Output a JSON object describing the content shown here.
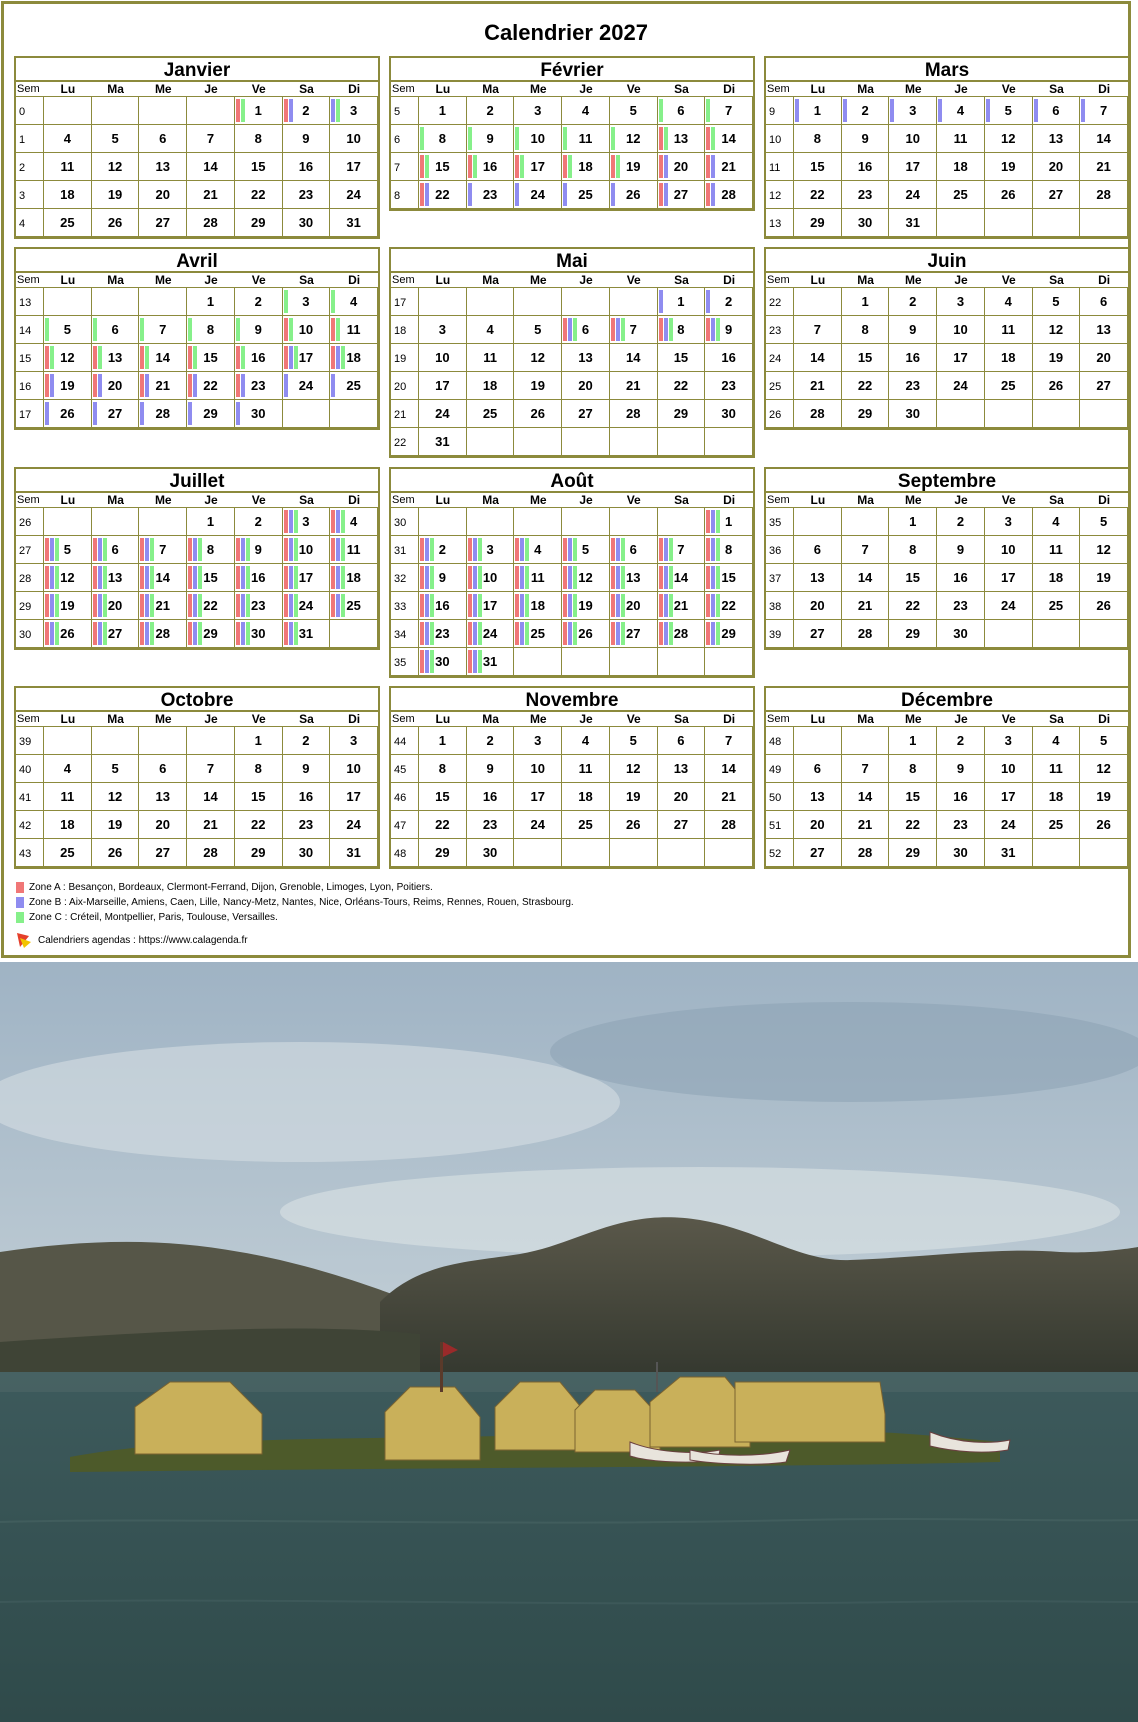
{
  "title": "Calendrier 2027",
  "weekday_header": [
    "Sem",
    "Lu",
    "Ma",
    "Me",
    "Je",
    "Ve",
    "Sa",
    "Di"
  ],
  "months": [
    {
      "name": "Janvier",
      "start": 4,
      "days": 31,
      "weeks": [
        0,
        1,
        2,
        3,
        4
      ],
      "zones": {
        "1": [
          "A",
          "C"
        ],
        "2": [
          "A",
          "B"
        ],
        "3": [
          "B",
          "C"
        ]
      }
    },
    {
      "name": "Février",
      "start": 0,
      "days": 28,
      "weeks": [
        5,
        6,
        7,
        8
      ],
      "zones": {
        "6": [
          "C"
        ],
        "7": [
          "C"
        ],
        "8": [
          "C"
        ],
        "9": [
          "C"
        ],
        "10": [
          "C"
        ],
        "11": [
          "C"
        ],
        "12": [
          "C"
        ],
        "13": [
          "A",
          "C"
        ],
        "14": [
          "A",
          "C"
        ],
        "15": [
          "A",
          "C"
        ],
        "16": [
          "A",
          "C"
        ],
        "17": [
          "A",
          "C"
        ],
        "18": [
          "A",
          "C"
        ],
        "19": [
          "A",
          "C"
        ],
        "20": [
          "A",
          "B"
        ],
        "21": [
          "A",
          "B"
        ],
        "22": [
          "A",
          "B"
        ],
        "23": [
          "B"
        ],
        "24": [
          "B"
        ],
        "25": [
          "B"
        ],
        "26": [
          "B"
        ],
        "27": [
          "A",
          "B"
        ],
        "28": [
          "A",
          "B"
        ]
      }
    },
    {
      "name": "Mars",
      "start": 0,
      "days": 31,
      "weeks": [
        9,
        10,
        11,
        12,
        13
      ],
      "zones": {
        "1": [
          "B"
        ],
        "2": [
          "B"
        ],
        "3": [
          "B"
        ],
        "4": [
          "B"
        ],
        "5": [
          "B"
        ],
        "6": [
          "B"
        ],
        "7": [
          "B"
        ]
      }
    },
    {
      "name": "Avril",
      "start": 3,
      "days": 30,
      "weeks": [
        13,
        14,
        15,
        16,
        17
      ],
      "zones": {
        "3": [
          "C"
        ],
        "4": [
          "C"
        ],
        "5": [
          "C"
        ],
        "6": [
          "C"
        ],
        "7": [
          "C"
        ],
        "8": [
          "C"
        ],
        "9": [
          "C"
        ],
        "10": [
          "A",
          "C"
        ],
        "11": [
          "A",
          "C"
        ],
        "12": [
          "A",
          "C"
        ],
        "13": [
          "A",
          "C"
        ],
        "14": [
          "A",
          "C"
        ],
        "15": [
          "A",
          "C"
        ],
        "16": [
          "A",
          "C"
        ],
        "17": [
          "A",
          "B",
          "C"
        ],
        "18": [
          "A",
          "B",
          "C"
        ],
        "19": [
          "A",
          "B"
        ],
        "20": [
          "A",
          "B"
        ],
        "21": [
          "A",
          "B"
        ],
        "22": [
          "A",
          "B"
        ],
        "23": [
          "A",
          "B"
        ],
        "24": [
          "B"
        ],
        "25": [
          "B"
        ],
        "26": [
          "B"
        ],
        "27": [
          "B"
        ],
        "28": [
          "B"
        ],
        "29": [
          "B"
        ],
        "30": [
          "B"
        ]
      }
    },
    {
      "name": "Mai",
      "start": 5,
      "days": 31,
      "weeks": [
        17,
        18,
        19,
        20,
        21,
        22
      ],
      "zones": {
        "1": [
          "B"
        ],
        "2": [
          "B"
        ],
        "6": [
          "A",
          "B",
          "C"
        ],
        "7": [
          "A",
          "B",
          "C"
        ],
        "8": [
          "A",
          "B",
          "C"
        ],
        "9": [
          "A",
          "B",
          "C"
        ]
      }
    },
    {
      "name": "Juin",
      "start": 1,
      "days": 30,
      "weeks": [
        22,
        23,
        24,
        25,
        26
      ],
      "zones": {}
    },
    {
      "name": "Juillet",
      "start": 3,
      "days": 31,
      "weeks": [
        26,
        27,
        28,
        29,
        30
      ],
      "zones": {
        "3": [
          "A",
          "B",
          "C"
        ],
        "4": [
          "A",
          "B",
          "C"
        ],
        "5": [
          "A",
          "B",
          "C"
        ],
        "6": [
          "A",
          "B",
          "C"
        ],
        "7": [
          "A",
          "B",
          "C"
        ],
        "8": [
          "A",
          "B",
          "C"
        ],
        "9": [
          "A",
          "B",
          "C"
        ],
        "10": [
          "A",
          "B",
          "C"
        ],
        "11": [
          "A",
          "B",
          "C"
        ],
        "12": [
          "A",
          "B",
          "C"
        ],
        "13": [
          "A",
          "B",
          "C"
        ],
        "14": [
          "A",
          "B",
          "C"
        ],
        "15": [
          "A",
          "B",
          "C"
        ],
        "16": [
          "A",
          "B",
          "C"
        ],
        "17": [
          "A",
          "B",
          "C"
        ],
        "18": [
          "A",
          "B",
          "C"
        ],
        "19": [
          "A",
          "B",
          "C"
        ],
        "20": [
          "A",
          "B",
          "C"
        ],
        "21": [
          "A",
          "B",
          "C"
        ],
        "22": [
          "A",
          "B",
          "C"
        ],
        "23": [
          "A",
          "B",
          "C"
        ],
        "24": [
          "A",
          "B",
          "C"
        ],
        "25": [
          "A",
          "B",
          "C"
        ],
        "26": [
          "A",
          "B",
          "C"
        ],
        "27": [
          "A",
          "B",
          "C"
        ],
        "28": [
          "A",
          "B",
          "C"
        ],
        "29": [
          "A",
          "B",
          "C"
        ],
        "30": [
          "A",
          "B",
          "C"
        ],
        "31": [
          "A",
          "B",
          "C"
        ]
      }
    },
    {
      "name": "Août",
      "start": 6,
      "days": 31,
      "weeks": [
        30,
        31,
        32,
        33,
        34,
        35
      ],
      "zones": {
        "1": [
          "A",
          "B",
          "C"
        ],
        "2": [
          "A",
          "B",
          "C"
        ],
        "3": [
          "A",
          "B",
          "C"
        ],
        "4": [
          "A",
          "B",
          "C"
        ],
        "5": [
          "A",
          "B",
          "C"
        ],
        "6": [
          "A",
          "B",
          "C"
        ],
        "7": [
          "A",
          "B",
          "C"
        ],
        "8": [
          "A",
          "B",
          "C"
        ],
        "9": [
          "A",
          "B",
          "C"
        ],
        "10": [
          "A",
          "B",
          "C"
        ],
        "11": [
          "A",
          "B",
          "C"
        ],
        "12": [
          "A",
          "B",
          "C"
        ],
        "13": [
          "A",
          "B",
          "C"
        ],
        "14": [
          "A",
          "B",
          "C"
        ],
        "15": [
          "A",
          "B",
          "C"
        ],
        "16": [
          "A",
          "B",
          "C"
        ],
        "17": [
          "A",
          "B",
          "C"
        ],
        "18": [
          "A",
          "B",
          "C"
        ],
        "19": [
          "A",
          "B",
          "C"
        ],
        "20": [
          "A",
          "B",
          "C"
        ],
        "21": [
          "A",
          "B",
          "C"
        ],
        "22": [
          "A",
          "B",
          "C"
        ],
        "23": [
          "A",
          "B",
          "C"
        ],
        "24": [
          "A",
          "B",
          "C"
        ],
        "25": [
          "A",
          "B",
          "C"
        ],
        "26": [
          "A",
          "B",
          "C"
        ],
        "27": [
          "A",
          "B",
          "C"
        ],
        "28": [
          "A",
          "B",
          "C"
        ],
        "29": [
          "A",
          "B",
          "C"
        ],
        "30": [
          "A",
          "B",
          "C"
        ],
        "31": [
          "A",
          "B",
          "C"
        ]
      }
    },
    {
      "name": "Septembre",
      "start": 2,
      "days": 30,
      "weeks": [
        35,
        36,
        37,
        38,
        39
      ],
      "zones": {}
    },
    {
      "name": "Octobre",
      "start": 4,
      "days": 31,
      "weeks": [
        39,
        40,
        41,
        42,
        43
      ],
      "zones": {}
    },
    {
      "name": "Novembre",
      "start": 0,
      "days": 30,
      "weeks": [
        44,
        45,
        46,
        47,
        48
      ],
      "zones": {}
    },
    {
      "name": "Décembre",
      "start": 2,
      "days": 31,
      "weeks": [
        48,
        49,
        50,
        51,
        52
      ],
      "zones": {}
    }
  ],
  "legend": [
    {
      "zone": "A",
      "color": "#f07777",
      "text": "Zone A : Besançon, Bordeaux, Clermont-Ferrand, Dijon, Grenoble, Limoges, Lyon, Poitiers."
    },
    {
      "zone": "B",
      "color": "#8f8cf0",
      "text": "Zone B : Aix-Marseille, Amiens, Caen, Lille, Nancy-Metz, Nantes, Nice, Orléans-Tours, Reims, Rennes, Rouen, Strasbourg."
    },
    {
      "zone": "C",
      "color": "#86f08a",
      "text": "Zone C : Créteil, Montpellier, Paris, Toulouse, Versailles."
    }
  ],
  "credit": "Calendriers agendas : https://www.calagenda.fr",
  "photo": {
    "subject": "reed-islands-lake-photo"
  }
}
